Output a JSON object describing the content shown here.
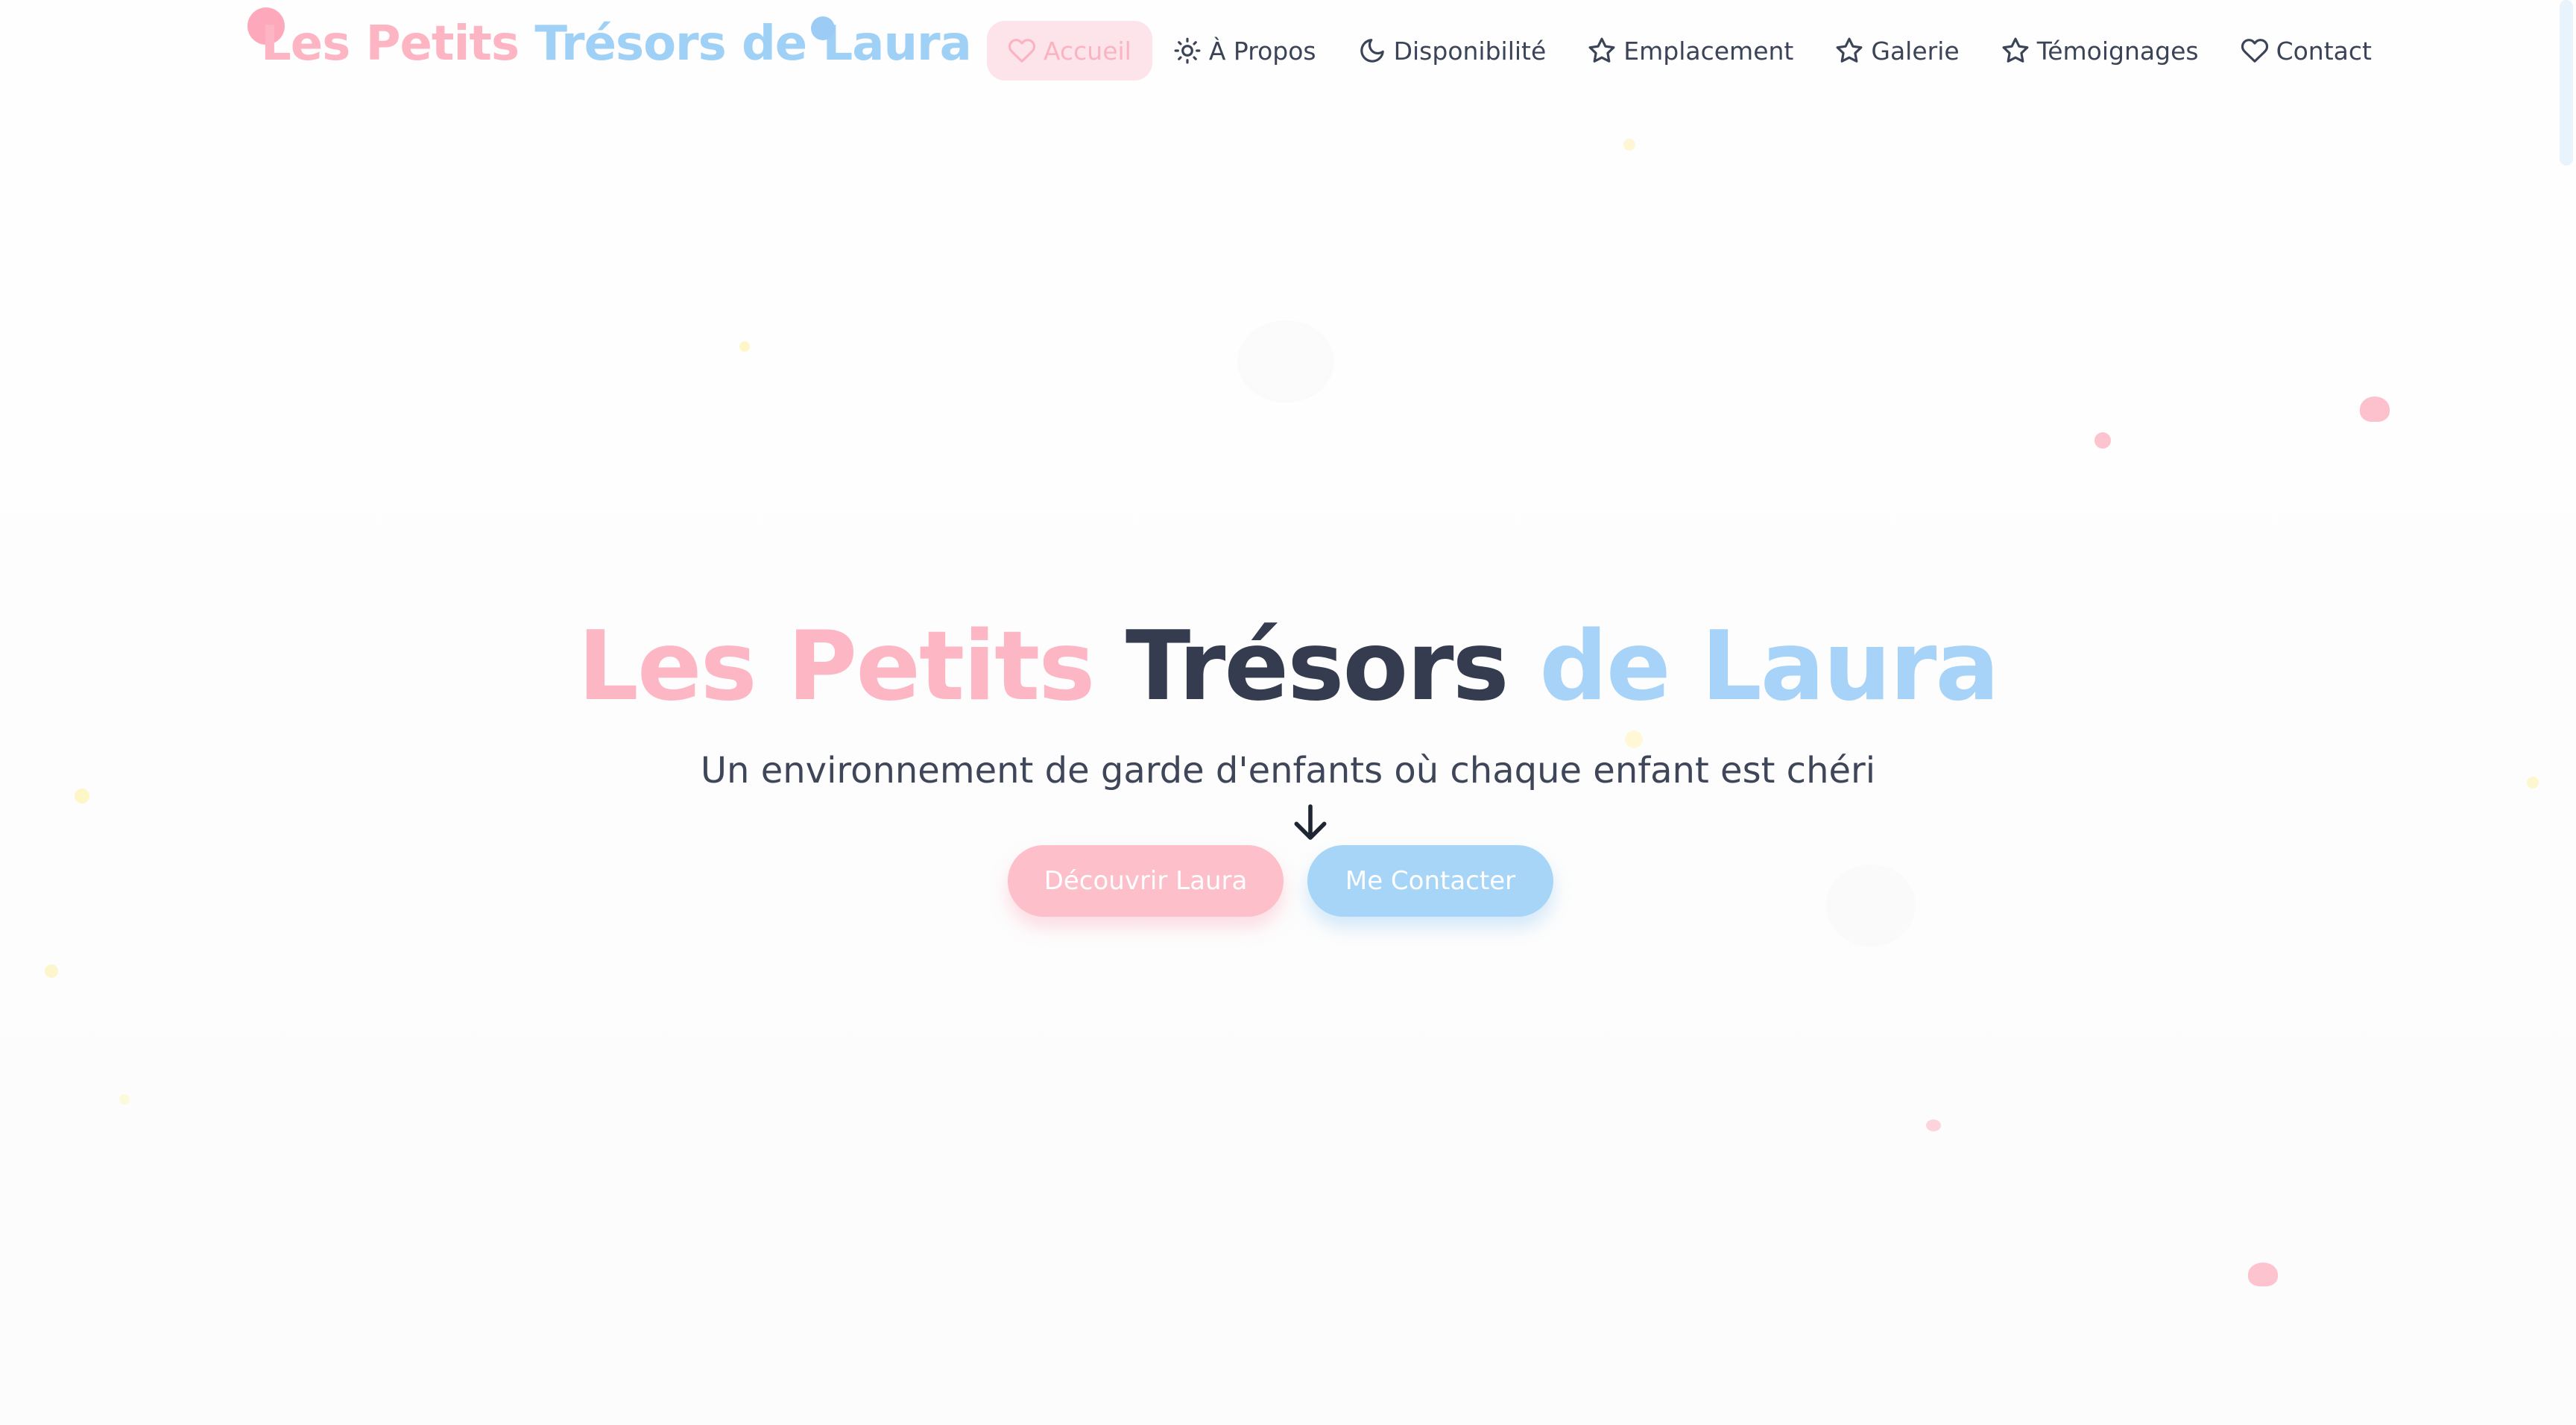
{
  "brand": {
    "part1": "Les Petits",
    "part2": "Trésors de Laura",
    "colors": {
      "pink": "#fdb5c4",
      "blue": "#9fd0f6",
      "dark": "#353c4f"
    }
  },
  "nav": {
    "items": [
      {
        "label": "Accueil",
        "icon": "heart-icon",
        "active": true
      },
      {
        "label": "À Propos",
        "icon": "sun-icon",
        "active": false
      },
      {
        "label": "Disponibilité",
        "icon": "moon-icon",
        "active": false
      },
      {
        "label": "Emplacement",
        "icon": "star-icon",
        "active": false
      },
      {
        "label": "Galerie",
        "icon": "star-icon",
        "active": false
      },
      {
        "label": "Témoignages",
        "icon": "star-icon",
        "active": false
      },
      {
        "label": "Contact",
        "icon": "heart-icon",
        "active": false
      }
    ]
  },
  "hero": {
    "title_part1": "Les Petits",
    "title_part2": "Trésors",
    "title_part3": "de Laura",
    "subtitle": "Un environnement de garde d'enfants où chaque enfant est chéri",
    "primary_button": "Découvrir Laura",
    "secondary_button": "Me Contacter",
    "scroll_icon": "arrow-down-icon"
  }
}
